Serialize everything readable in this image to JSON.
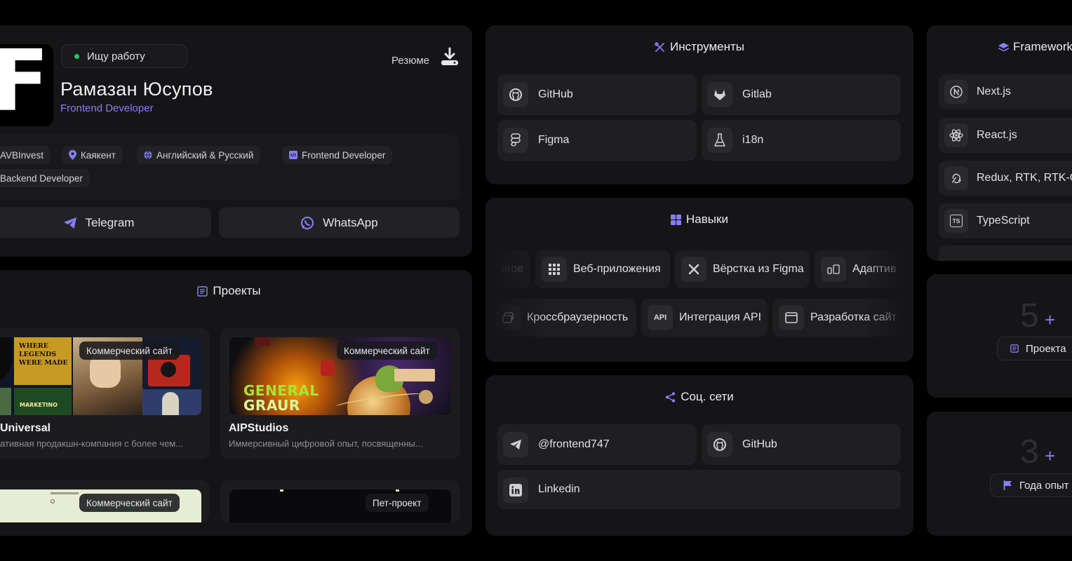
{
  "profile": {
    "status": "Ищу работу",
    "resume_label": "Резюме",
    "name": "Рамазан Юсупов",
    "role": "Frontend Developer",
    "tags": [
      "AVBInvest",
      "Каякент",
      "Английский & Русский",
      "Frontend Developer",
      "Backend Developer"
    ],
    "contacts": {
      "telegram": "Telegram",
      "whatsapp": "WhatsApp"
    },
    "avatar_letter": "F"
  },
  "projects": {
    "title": "Проекты",
    "items": [
      {
        "badge": "Коммерческий сайт",
        "name": "Universal",
        "desc": "ативная продакшн-компания с более чем..."
      },
      {
        "badge": "Коммерческий сайт",
        "name": "AIPStudios",
        "desc": "Иммерсивный цифровой опыт, посвященны..."
      },
      {
        "badge": "Коммерческий сайт",
        "name": "",
        "desc": ""
      },
      {
        "badge": "Пет-проект",
        "name": "",
        "desc": ""
      }
    ],
    "image_text": {
      "legends": "WHERE LEGENDS WERE MADE",
      "marketing": "MARKETINO",
      "general": "GENERAL",
      "graur": "GRAUR"
    }
  },
  "tools": {
    "title": "Инструменты",
    "items": [
      {
        "label": "GitHub",
        "icon": "github-icon"
      },
      {
        "label": "Gitlab",
        "icon": "gitlab-icon"
      },
      {
        "label": "Figma",
        "icon": "figma-icon"
      },
      {
        "label": "i18n",
        "icon": "flask-icon"
      }
    ]
  },
  "skills": {
    "title": "Навыки",
    "row1": [
      "нгов",
      "Веб-приложения",
      "Вёрстка из Figma",
      "Адаптив"
    ],
    "row2": [
      "Кроссбраузерность",
      "Интеграция API",
      "Разработка сайт"
    ],
    "api_icon_text": "API"
  },
  "social": {
    "title": "Соц. сети",
    "items": [
      {
        "label": "@frontend747",
        "icon": "telegram-icon"
      },
      {
        "label": "GitHub",
        "icon": "github-icon"
      },
      {
        "label": "Linkedin",
        "icon": "linkedin-icon"
      }
    ]
  },
  "frameworks": {
    "title": "Framework",
    "items": [
      {
        "label": "Next.js",
        "icon": "nextjs-icon"
      },
      {
        "label": "React.js",
        "icon": "react-icon"
      },
      {
        "label": "Redux, RTK, RTK-Qu",
        "icon": "redux-icon"
      },
      {
        "label": "TypeScript",
        "icon": "typescript-icon"
      }
    ],
    "ts_icon_text": "TS"
  },
  "stats": [
    {
      "number": "5",
      "plus": "+",
      "label": "Проекта"
    },
    {
      "number": "3",
      "plus": "+",
      "label": "Года опыт"
    }
  ],
  "colors": {
    "accent": "#8b7cf6",
    "card": "#151517",
    "background": "#000000",
    "online": "#22c55e"
  }
}
